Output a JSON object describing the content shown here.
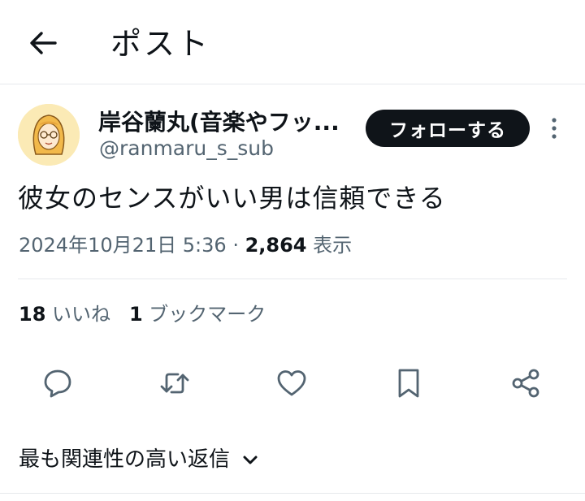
{
  "header": {
    "title": "ポスト"
  },
  "author": {
    "name": "岸谷蘭丸(音楽やフッ...",
    "handle": "@ranmaru_s_sub"
  },
  "follow_label": "フォローする",
  "post": {
    "text": "彼女のセンスがいい男は信頼できる"
  },
  "meta": {
    "datetime": "2024年10月21日 5:36",
    "separator": " · ",
    "views_count": "2,864",
    "views_label": " 表示"
  },
  "stats": {
    "likes_count": "18",
    "likes_label": " いいね",
    "bookmarks_count": "1",
    "bookmarks_label": " ブックマーク"
  },
  "replies_sort_label": "最も関連性の高い返信",
  "icons": {
    "back": "arrow-left-icon",
    "more": "vertical-dots-icon",
    "reply": "speech-bubble-icon",
    "repost": "repost-arrows-icon",
    "like": "heart-icon",
    "bookmark": "bookmark-icon",
    "share": "share-nodes-icon",
    "sort": "chevron-down-icon"
  },
  "colors": {
    "text": "#0f1419",
    "secondary": "#536471",
    "divider": "#e6e9ec",
    "follow_bg": "#0f1419",
    "avatar_bg": "#fbeab5"
  }
}
